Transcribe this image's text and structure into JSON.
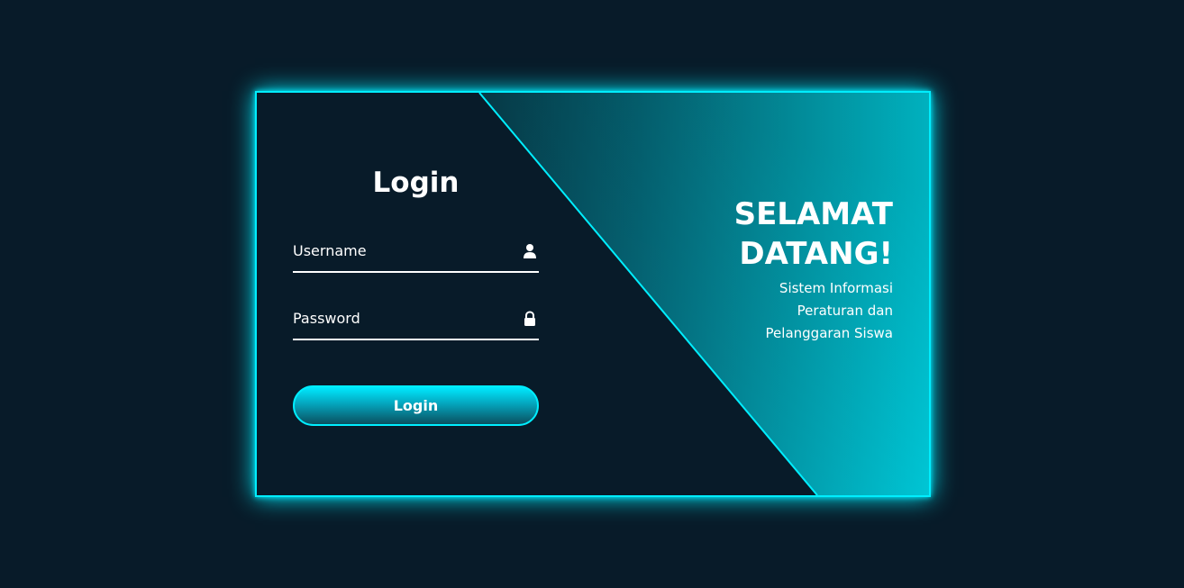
{
  "colors": {
    "background": "#081b29",
    "accent": "#00eeff",
    "text": "#ffffff"
  },
  "login": {
    "title": "Login",
    "username_label": "Username",
    "username_icon": "user-icon",
    "password_label": "Password",
    "password_icon": "lock-icon",
    "submit_label": "Login"
  },
  "welcome": {
    "heading_line1": "SELAMAT",
    "heading_line2": "DATANG!",
    "subtitle_line1": "Sistem Informasi",
    "subtitle_line2": "Peraturan dan",
    "subtitle_line3": "Pelanggaran Siswa"
  }
}
